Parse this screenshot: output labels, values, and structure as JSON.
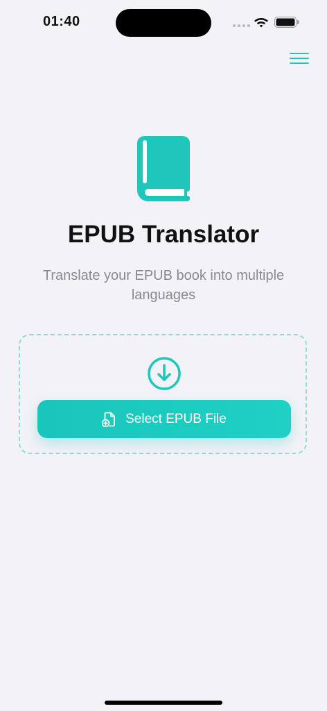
{
  "status_bar": {
    "time": "01:40"
  },
  "colors": {
    "accent": "#1FC7BB",
    "background": "#F2F2F7",
    "subtitle": "#8A8A8E"
  },
  "header": {
    "menu_icon": "hamburger-menu-icon"
  },
  "hero": {
    "icon": "book-icon",
    "title": "EPUB Translator",
    "subtitle": "Translate your EPUB book into multiple languages"
  },
  "upload": {
    "icon": "download-circle-icon",
    "button_label": "Select EPUB File",
    "button_icon": "file-add-icon"
  }
}
